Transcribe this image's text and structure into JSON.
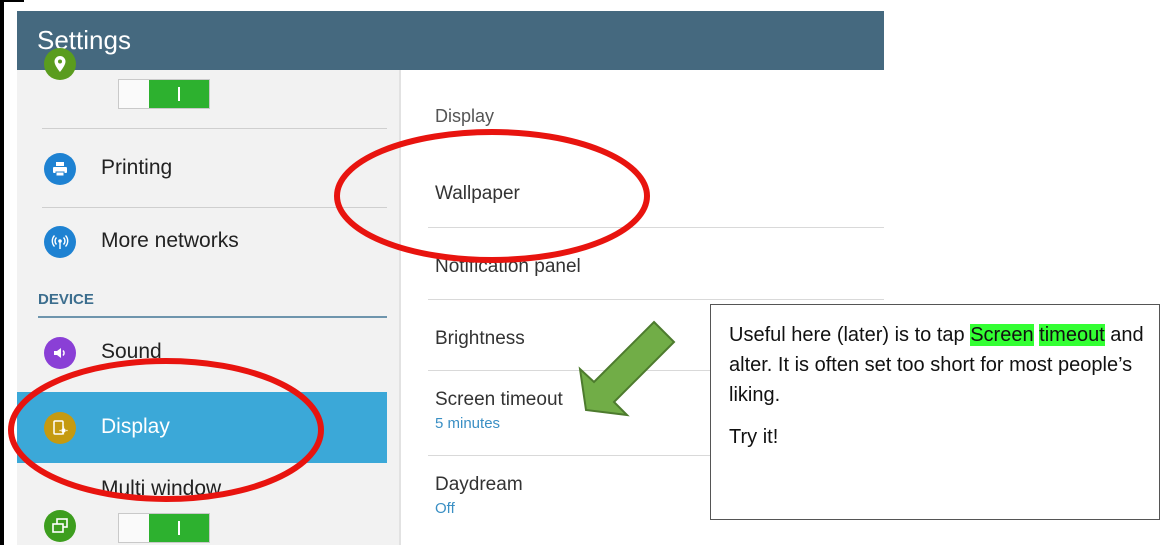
{
  "app": {
    "title": "Settings"
  },
  "sidebar": {
    "location": {
      "toggle_state": "on"
    },
    "printing": {
      "label": "Printing"
    },
    "more_networks": {
      "label": "More networks"
    },
    "section_header": "DEVICE",
    "sound": {
      "label": "Sound"
    },
    "display": {
      "label": "Display",
      "selected": true
    },
    "multi_window": {
      "label": "Multi window",
      "toggle_state": "on"
    }
  },
  "main": {
    "section_title": "Display",
    "items": [
      {
        "label": "Wallpaper",
        "sub": ""
      },
      {
        "label": "Notification panel",
        "sub": ""
      },
      {
        "label": "Brightness",
        "sub": ""
      },
      {
        "label": "Screen timeout",
        "sub": "5 minutes"
      },
      {
        "label": "Daydream",
        "sub": "Off"
      }
    ]
  },
  "callout": {
    "line1_a": "Useful here (later) is to tap ",
    "line1_highlight_a": "Screen",
    "line1_highlight_b": "timeout",
    "line1_b": " and alter. It is often set too short for most people’s liking.",
    "line2": "Try it!"
  },
  "colors": {
    "titlebar": "#45697f",
    "selected_row": "#3ba8d8",
    "toggle_on": "#2db12f",
    "annotation_red": "#e8140f",
    "arrow_green": "#71ad47",
    "highlight": "#33ff33"
  },
  "icons": {
    "location": "location-pin-icon",
    "printing": "printer-icon",
    "more_networks": "wireless-signal-icon",
    "sound": "speaker-icon",
    "display": "display-icon",
    "multi_window": "multi-window-icon"
  }
}
